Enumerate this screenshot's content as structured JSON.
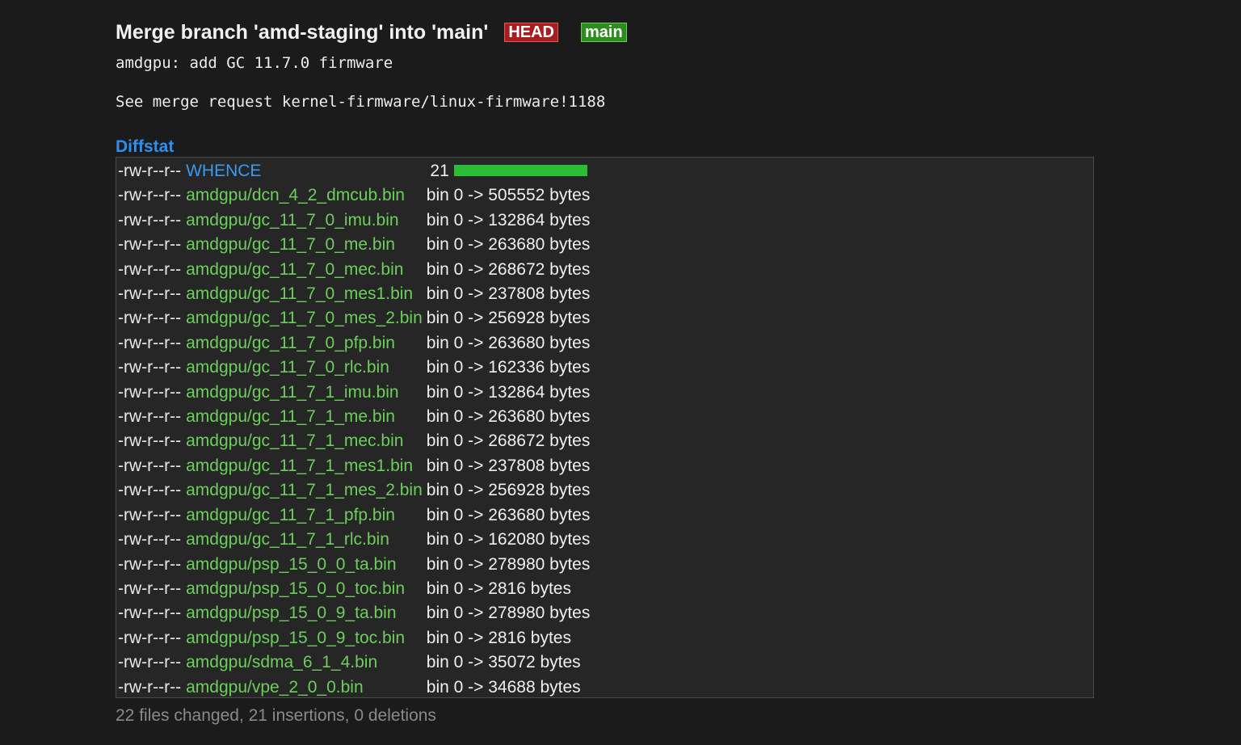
{
  "commit": {
    "title": "Merge branch 'amd-staging' into 'main'",
    "refs": {
      "head": "HEAD",
      "branch": "main"
    },
    "message_line1": "amdgpu: add GC 11.7.0 firmware",
    "message_line2": "See merge request kernel-firmware/linux-firmware!1188"
  },
  "diffstat": {
    "header": "Diffstat",
    "colors": {
      "added_file": "#6ccf5c",
      "modified_file": "#3a9af2",
      "bar": "#2dbc36"
    },
    "rows": [
      {
        "mode": "-rw-r--r--",
        "name": "WHENCE",
        "stat": "21",
        "bar_fraction": 1.0
      },
      {
        "mode": "-rw-r--r--",
        "name": "amdgpu/dcn_4_2_dmcub.bin",
        "stat": "bin 0 -> 505552 bytes"
      },
      {
        "mode": "-rw-r--r--",
        "name": "amdgpu/gc_11_7_0_imu.bin",
        "stat": "bin 0 -> 132864 bytes"
      },
      {
        "mode": "-rw-r--r--",
        "name": "amdgpu/gc_11_7_0_me.bin",
        "stat": "bin 0 -> 263680 bytes"
      },
      {
        "mode": "-rw-r--r--",
        "name": "amdgpu/gc_11_7_0_mec.bin",
        "stat": "bin 0 -> 268672 bytes"
      },
      {
        "mode": "-rw-r--r--",
        "name": "amdgpu/gc_11_7_0_mes1.bin",
        "stat": "bin 0 -> 237808 bytes"
      },
      {
        "mode": "-rw-r--r--",
        "name": "amdgpu/gc_11_7_0_mes_2.bin",
        "stat": "bin 0 -> 256928 bytes"
      },
      {
        "mode": "-rw-r--r--",
        "name": "amdgpu/gc_11_7_0_pfp.bin",
        "stat": "bin 0 -> 263680 bytes"
      },
      {
        "mode": "-rw-r--r--",
        "name": "amdgpu/gc_11_7_0_rlc.bin",
        "stat": "bin 0 -> 162336 bytes"
      },
      {
        "mode": "-rw-r--r--",
        "name": "amdgpu/gc_11_7_1_imu.bin",
        "stat": "bin 0 -> 132864 bytes"
      },
      {
        "mode": "-rw-r--r--",
        "name": "amdgpu/gc_11_7_1_me.bin",
        "stat": "bin 0 -> 263680 bytes"
      },
      {
        "mode": "-rw-r--r--",
        "name": "amdgpu/gc_11_7_1_mec.bin",
        "stat": "bin 0 -> 268672 bytes"
      },
      {
        "mode": "-rw-r--r--",
        "name": "amdgpu/gc_11_7_1_mes1.bin",
        "stat": "bin 0 -> 237808 bytes"
      },
      {
        "mode": "-rw-r--r--",
        "name": "amdgpu/gc_11_7_1_mes_2.bin",
        "stat": "bin 0 -> 256928 bytes"
      },
      {
        "mode": "-rw-r--r--",
        "name": "amdgpu/gc_11_7_1_pfp.bin",
        "stat": "bin 0 -> 263680 bytes"
      },
      {
        "mode": "-rw-r--r--",
        "name": "amdgpu/gc_11_7_1_rlc.bin",
        "stat": "bin 0 -> 162080 bytes"
      },
      {
        "mode": "-rw-r--r--",
        "name": "amdgpu/psp_15_0_0_ta.bin",
        "stat": "bin 0 -> 278980 bytes"
      },
      {
        "mode": "-rw-r--r--",
        "name": "amdgpu/psp_15_0_0_toc.bin",
        "stat": "bin 0 -> 2816 bytes"
      },
      {
        "mode": "-rw-r--r--",
        "name": "amdgpu/psp_15_0_9_ta.bin",
        "stat": "bin 0 -> 278980 bytes"
      },
      {
        "mode": "-rw-r--r--",
        "name": "amdgpu/psp_15_0_9_toc.bin",
        "stat": "bin 0 -> 2816 bytes"
      },
      {
        "mode": "-rw-r--r--",
        "name": "amdgpu/sdma_6_1_4.bin",
        "stat": "bin 0 -> 35072 bytes"
      },
      {
        "mode": "-rw-r--r--",
        "name": "amdgpu/vpe_2_0_0.bin",
        "stat": "bin 0 -> 34688 bytes"
      }
    ],
    "summary": "22 files changed, 21 insertions, 0 deletions"
  }
}
